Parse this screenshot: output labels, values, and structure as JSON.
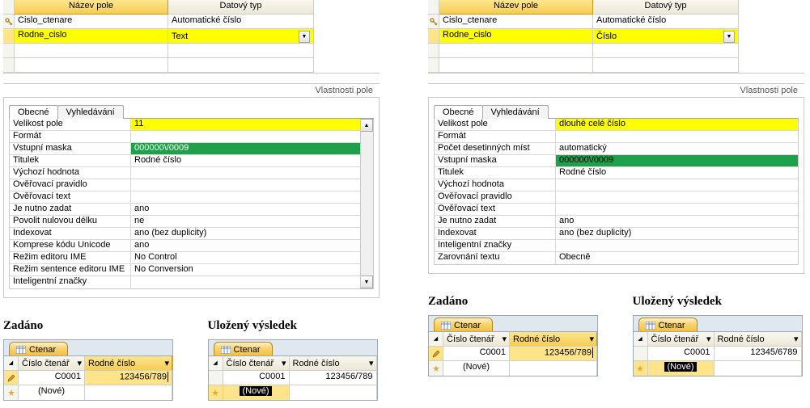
{
  "grid_headers": {
    "name": "Název pole",
    "type": "Datový typ"
  },
  "left": {
    "rows": [
      {
        "name": "Cislo_ctenare",
        "type": "Automatické číslo",
        "key": true
      },
      {
        "name": "Rodne_cislo",
        "type": "Text",
        "selected": true
      }
    ],
    "props_title": "Vlastnosti pole",
    "tabs": {
      "general": "Obecné",
      "lookup": "Vyhledávání"
    },
    "props": [
      {
        "label": "Velikost pole",
        "value": "11",
        "style": "yellow"
      },
      {
        "label": "Formát",
        "value": ""
      },
      {
        "label": "Vstupní maska",
        "value": "000000\\/0009",
        "style": "greensel"
      },
      {
        "label": "Titulek",
        "value": "Rodné číslo"
      },
      {
        "label": "Výchozí hodnota",
        "value": ""
      },
      {
        "label": "Ověřovací pravidlo",
        "value": ""
      },
      {
        "label": "Ověřovací text",
        "value": ""
      },
      {
        "label": "Je nutno zadat",
        "value": "ano"
      },
      {
        "label": "Povolit nulovou délku",
        "value": "ne"
      },
      {
        "label": "Indexovat",
        "value": "ano (bez duplicity)"
      },
      {
        "label": "Komprese kódu Unicode",
        "value": "ano"
      },
      {
        "label": "Režim editoru IME",
        "value": "No Control"
      },
      {
        "label": "Režim sentence editoru IME",
        "value": "No Conversion"
      },
      {
        "label": "Inteligentní značky",
        "value": ""
      }
    ],
    "bottom": {
      "entered_label": "Zadáno",
      "saved_label": "Uložený výsledek",
      "tab_name": "Ctenar",
      "col1": "Číslo čtenář",
      "col2": "Rodné číslo",
      "entered": {
        "id": "C0001",
        "value": "123456/789",
        "caret": true,
        "pencil": true
      },
      "saved": {
        "id": "C0001",
        "value": "123456/789",
        "caret": false,
        "pencil": false
      },
      "nove": "(Nové)"
    }
  },
  "right": {
    "rows": [
      {
        "name": "Cislo_ctenare",
        "type": "Automatické číslo",
        "key": true
      },
      {
        "name": "Rodne_cislo",
        "type": "Číslo",
        "selected": true
      }
    ],
    "props_title": "Vlastnosti pole",
    "tabs": {
      "general": "Obecné",
      "lookup": "Vyhledávání"
    },
    "props": [
      {
        "label": "Velikost pole",
        "value": "dlouhé celé číslo",
        "style": "yellow"
      },
      {
        "label": "Formát",
        "value": ""
      },
      {
        "label": "Počet desetinných míst",
        "value": "automatický"
      },
      {
        "label": "Vstupní maska",
        "value": "000000\\/0009",
        "style": "green"
      },
      {
        "label": "Titulek",
        "value": "Rodné číslo"
      },
      {
        "label": "Výchozí hodnota",
        "value": ""
      },
      {
        "label": "Ověřovací pravidlo",
        "value": ""
      },
      {
        "label": "Ověřovací text",
        "value": ""
      },
      {
        "label": "Je nutno zadat",
        "value": "ano"
      },
      {
        "label": "Indexovat",
        "value": "ano (bez duplicity)"
      },
      {
        "label": "Inteligentní značky",
        "value": ""
      },
      {
        "label": "Zarovnání textu",
        "value": "Obecně"
      }
    ],
    "bottom": {
      "entered_label": "Zadáno",
      "saved_label": "Uložený výsledek",
      "tab_name": "Ctenar",
      "col1": "Číslo čtenář",
      "col2": "Rodné číslo",
      "entered": {
        "id": "C0001",
        "value": "123456/789",
        "caret": true,
        "pencil": true
      },
      "saved": {
        "id": "C0001",
        "value": "12345/6789",
        "caret": false,
        "pencil": false
      },
      "nove": "(Nové)"
    }
  }
}
